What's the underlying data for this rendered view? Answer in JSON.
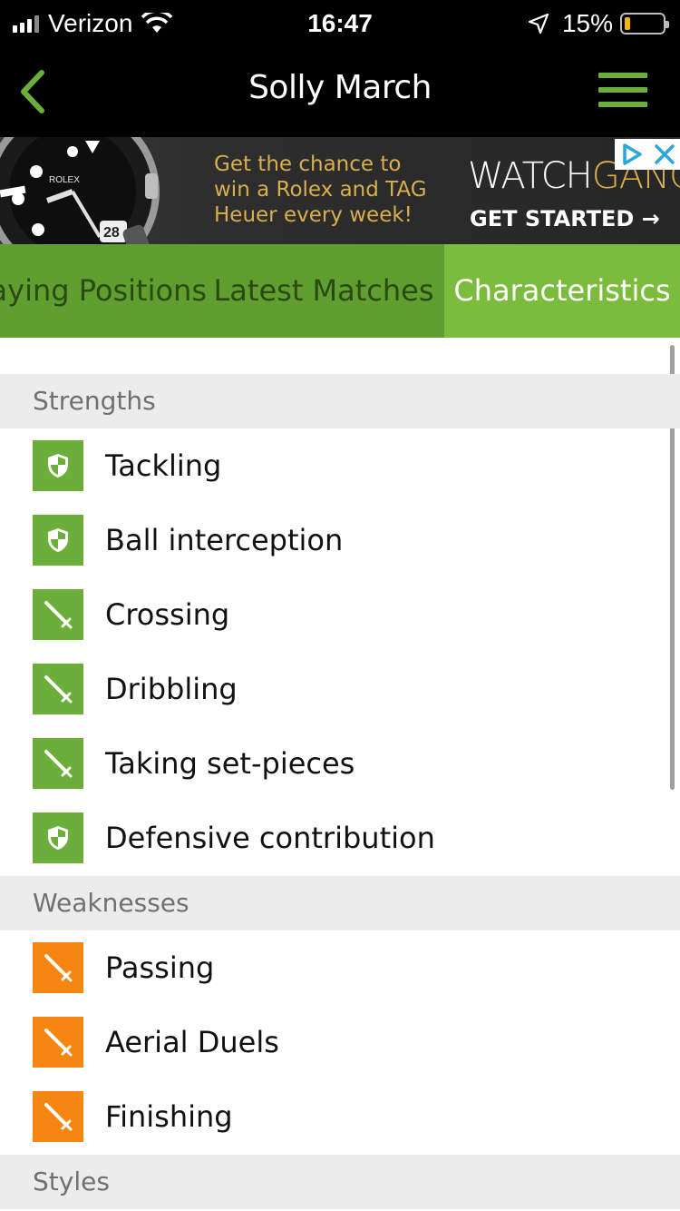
{
  "status_bar": {
    "carrier": "Verizon",
    "time": "16:47",
    "battery": "15%",
    "battery_level": 0.15,
    "icons": [
      "cellular-signal-icon",
      "wifi-icon",
      "location-arrow-icon",
      "battery-icon"
    ]
  },
  "nav": {
    "title": "Solly March",
    "back_icon": "chevron-left-icon",
    "menu_icon": "hamburger-menu-icon",
    "accent": "#6cae3a"
  },
  "ad": {
    "copy_line1": "Get the chance to",
    "copy_line2": "win a Rolex and TAG",
    "copy_line3": "Heuer every week!",
    "logo_part1": "WATCH",
    "logo_part2": "GANG",
    "cta": "GET STARTED →",
    "watch_text": "ROLEX",
    "watch_date": "28"
  },
  "tabs": [
    {
      "label": "Playing Positions",
      "visible_label": "aying Positions",
      "active": false
    },
    {
      "label": "Latest Matches",
      "visible_label": "Latest Matches",
      "active": false
    },
    {
      "label": "Characteristics",
      "visible_label": "Characteristics",
      "active": true
    }
  ],
  "sections": {
    "strengths": {
      "title": "Strengths",
      "items": [
        {
          "label": "Tackling",
          "icon": "shield-icon",
          "color": "green"
        },
        {
          "label": "Ball interception",
          "icon": "shield-icon",
          "color": "green"
        },
        {
          "label": "Crossing",
          "icon": "sword-icon",
          "color": "green"
        },
        {
          "label": "Dribbling",
          "icon": "sword-icon",
          "color": "green"
        },
        {
          "label": "Taking set-pieces",
          "icon": "sword-icon",
          "color": "green"
        },
        {
          "label": "Defensive contribution",
          "icon": "shield-icon",
          "color": "green"
        }
      ]
    },
    "weaknesses": {
      "title": "Weaknesses",
      "items": [
        {
          "label": "Passing",
          "icon": "sword-icon",
          "color": "orange"
        },
        {
          "label": "Aerial Duels",
          "icon": "sword-icon",
          "color": "orange"
        },
        {
          "label": "Finishing",
          "icon": "sword-icon",
          "color": "orange"
        }
      ]
    },
    "styles": {
      "title": "Styles"
    }
  },
  "colors": {
    "green": "#6cae3a",
    "orange": "#f68512",
    "tab_bar": "#5f9e2f",
    "tab_active": "#7cbc3c"
  }
}
